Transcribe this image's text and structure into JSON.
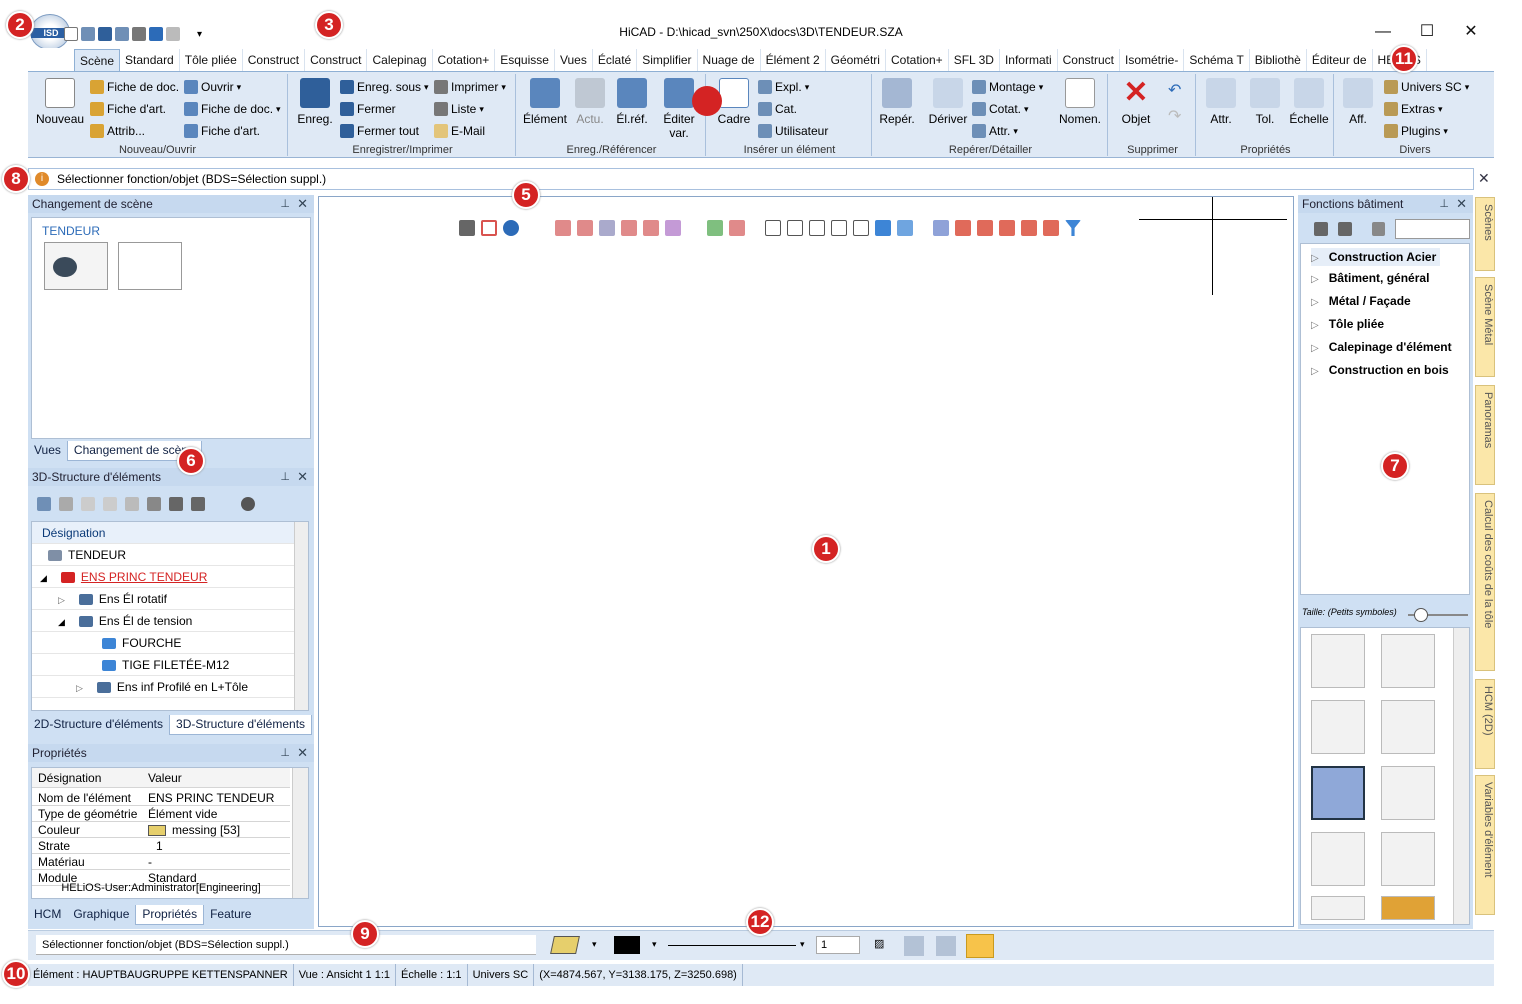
{
  "window": {
    "title": "HiCAD - D:\\hicad_svn\\250X\\docs\\3D\\TENDEUR.SZA",
    "app_button_label": "ISD",
    "controls": [
      "—",
      "☐",
      "✕"
    ]
  },
  "ribbon_tabs": [
    "Scène",
    "Standard",
    "Tôle pliée",
    "Construct",
    "Construct",
    "Calepinag",
    "Cotation+",
    "Esquisse",
    "Vues",
    "Éclaté",
    "Simplifier",
    "Nuage de",
    "Élément 2",
    "Géométri",
    "Cotation+",
    "SFL 3D",
    "Informati",
    "Construct",
    "Isométrie-",
    "Schéma T",
    "Bibliothè",
    "Éditeur de",
    "HELiOS"
  ],
  "ribbon_groups": {
    "nouveau": {
      "label": "Nouveau/Ouvrir",
      "big": "Nouveau",
      "items": [
        "Fiche de doc.",
        "Fiche d'art.",
        "Attrib...",
        "Ouvrir",
        "Fiche de doc.",
        "Fiche d'art."
      ]
    },
    "enreg": {
      "label": "Enregistrer/Imprimer",
      "big": "Enreg.",
      "items": [
        "Enreg. sous",
        "Fermer",
        "Fermer tout",
        "Imprimer",
        "Liste",
        "E-Mail"
      ]
    },
    "referencer": {
      "label": "Enreg./Référencer",
      "items": [
        "Élément",
        "Actu.",
        "Él.réf.",
        "Éditer var."
      ]
    },
    "inserer": {
      "label": "Insérer un élément",
      "items": [
        "Cadre",
        "Expl.",
        "Cat.",
        "Utilisateur"
      ]
    },
    "reperer": {
      "label": "Repérer/Détailler",
      "items": [
        "Repér.",
        "Dériver",
        "Montage",
        "Cotat.",
        "Attr.",
        "Nomen."
      ]
    },
    "supprimer": {
      "label": "Supprimer",
      "items": [
        "Objet"
      ]
    },
    "proprietes": {
      "label": "Propriétés",
      "items": [
        "Attr.",
        "Tol.",
        "Échelle"
      ]
    },
    "divers": {
      "label": "Divers",
      "items": [
        "Aff.",
        "Univers SC",
        "Extras",
        "Plugins"
      ]
    }
  },
  "message_bar": "Sélectionner fonction/objet (BDS=Sélection suppl.)",
  "left_panels": {
    "scene": {
      "title": "Changement de scène",
      "scene_name": "TENDEUR",
      "tabs": [
        "Vues",
        "Changement de scène"
      ]
    },
    "structure": {
      "title": "3D-Structure d'éléments",
      "column": "Désignation",
      "rows": [
        "TENDEUR",
        "ENS PRINC TENDEUR",
        "Ens Él rotatif",
        "Ens Él de tension",
        "FOURCHE",
        "TIGE FILETÉE-M12",
        "Ens inf Profilé en L+Tôle"
      ],
      "tabs": [
        "2D-Structure d'éléments",
        "3D-Structure d'éléments"
      ]
    },
    "properties": {
      "title": "Propriétés",
      "columns": [
        "Désignation",
        "Valeur"
      ],
      "rows": [
        {
          "key": "Nom de l'élément",
          "value": "ENS PRINC TENDEUR"
        },
        {
          "key": "Type de géométrie",
          "value": "Élément vide"
        },
        {
          "key": "Couleur",
          "value": "messing [53]"
        },
        {
          "key": "Strate",
          "value": "1"
        },
        {
          "key": "Matériau",
          "value": "-"
        },
        {
          "key": "Module",
          "value": "Standard"
        }
      ],
      "footer": "HELiOS-User:Administrator[Engineering]",
      "tabs": [
        "HCM",
        "Graphique",
        "Propriétés",
        "Feature"
      ]
    }
  },
  "right_panel": {
    "title": "Fonctions bâtiment",
    "items": [
      "Construction Acier",
      "Bâtiment, général",
      "Métal / Façade",
      "Tôle pliée",
      "Calepinage d'élément",
      "Construction en bois"
    ],
    "size_label": "Taille:",
    "size_value": "(Petits symboles)"
  },
  "vertical_tabs": [
    "Scènes",
    "Scène Métal",
    "Panoramas",
    "Calcul des coûts de la tôle",
    "HCM (2D)",
    "Variables d'élément"
  ],
  "command_bar": {
    "prompt": "Sélectionner fonction/objet (BDS=Sélection suppl.)",
    "line_width": "1"
  },
  "status_bar": [
    "Élément : HAUPTBAUGRUPPE KETTENSPANNER",
    "Vue : Ansicht 1 1:1",
    "Échelle : 1:1",
    "Univers SC",
    "(X=4874.567, Y=3138.175, Z=3250.698)"
  ],
  "markers": [
    "1",
    "2",
    "3",
    "5",
    "6",
    "7",
    "8",
    "9",
    "10",
    "11",
    "12"
  ],
  "colors": {
    "accent": "#d42323",
    "ribbon_bg": "#dfe9f5",
    "panel_bg": "#cfe0f3",
    "tab_yellow": "#fbe7a9"
  }
}
